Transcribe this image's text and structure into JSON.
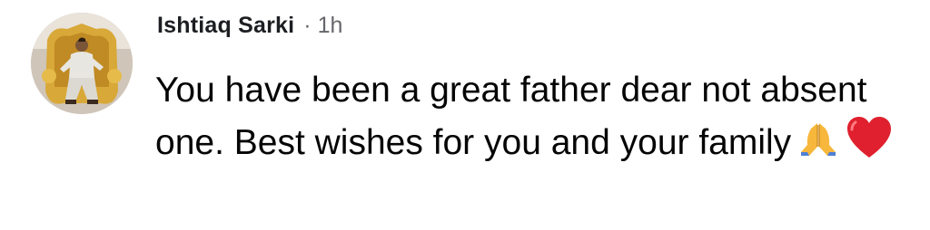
{
  "comment": {
    "author": "Ishtiaq Sarki",
    "separator": "·",
    "timestamp": "1h",
    "text": "You have been a great father dear not absent one. Best wishes for you and your family",
    "emojis": [
      "folded-hands-icon",
      "red-heart-icon"
    ]
  },
  "colors": {
    "author": "#1c1e21",
    "meta": "#65676b",
    "text": "#050505",
    "heart": "#e0202e",
    "hands": "#f6b73c"
  }
}
